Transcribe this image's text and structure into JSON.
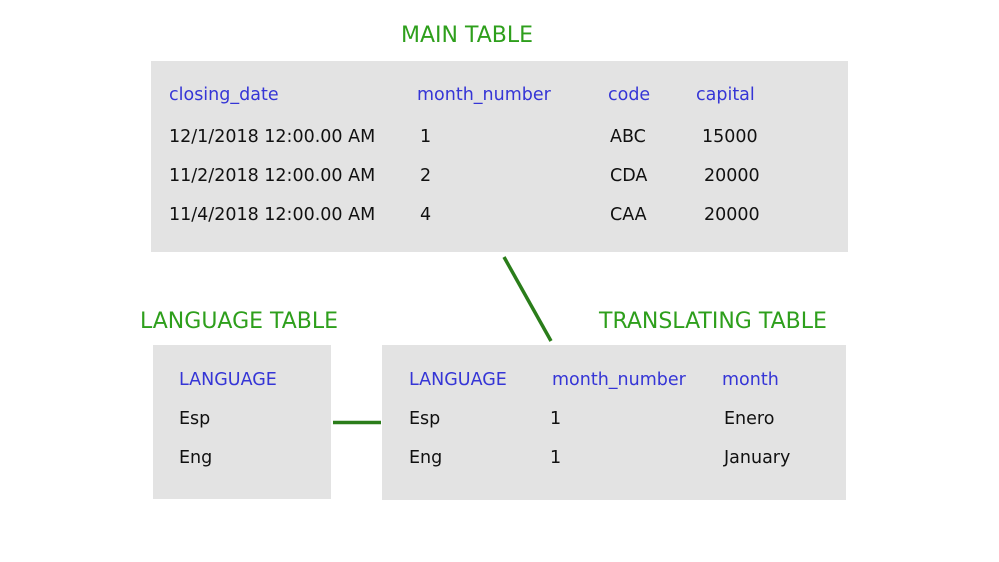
{
  "colors": {
    "title": "#2e9f1c",
    "header": "#3535d6",
    "cell": "#111111",
    "box_background": "#e3e3e3",
    "connector": "#2a7d1a"
  },
  "main_table": {
    "title": "MAIN TABLE",
    "columns": [
      "closing_date",
      "month_number",
      "code",
      "capital"
    ],
    "rows": [
      [
        "12/1/2018 12:00.00 AM",
        "1",
        "ABC",
        "15000"
      ],
      [
        "11/2/2018 12:00.00 AM",
        "2",
        "CDA",
        "20000"
      ],
      [
        "11/4/2018 12:00.00 AM",
        "4",
        "CAA",
        "20000"
      ]
    ]
  },
  "language_table": {
    "title": "LANGUAGE TABLE",
    "columns": [
      "LANGUAGE"
    ],
    "rows": [
      [
        "Esp"
      ],
      [
        "Eng"
      ]
    ]
  },
  "translating_table": {
    "title": "TRANSLATING TABLE",
    "columns": [
      "LANGUAGE",
      "month_number",
      "month"
    ],
    "rows": [
      [
        "Esp",
        "1",
        "Enero"
      ],
      [
        "Eng",
        "1",
        "January"
      ]
    ]
  },
  "relationships": [
    {
      "from": "main_table",
      "to": "translating_table",
      "on": "month_number"
    },
    {
      "from": "language_table",
      "to": "translating_table",
      "on": "LANGUAGE"
    }
  ]
}
